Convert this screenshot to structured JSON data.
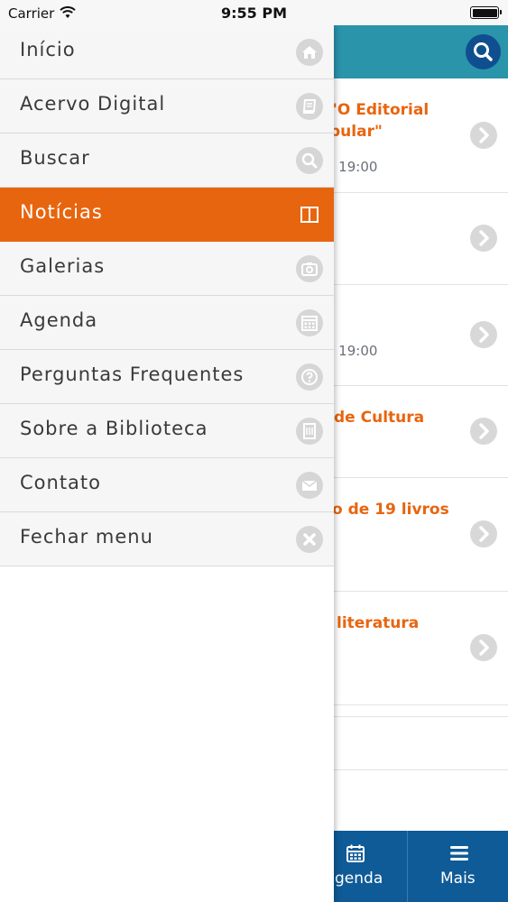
{
  "status_bar": {
    "carrier": "Carrier",
    "time": "9:55 PM"
  },
  "news": [
    {
      "title_line1": "\"O Editorial",
      "title_line2": "pular\"",
      "meta": "- 19:00"
    },
    {
      "title_line1": "",
      "title_line2": "",
      "meta": ""
    },
    {
      "title_line1": "",
      "title_line2": "",
      "meta": "- 19:00"
    },
    {
      "title_line1": "de Cultura",
      "title_line2": "",
      "meta": ""
    },
    {
      "title_line1": "o de 19 livros",
      "title_line2": "",
      "meta": ""
    },
    {
      "title_line1": "literatura",
      "title_line2": "",
      "meta": ""
    }
  ],
  "tabbar": {
    "agenda_label": "genda",
    "mais_label": "Mais"
  },
  "menu": {
    "items": [
      {
        "label": "Início",
        "icon": "home-icon"
      },
      {
        "label": "Acervo Digital",
        "icon": "book-icon"
      },
      {
        "label": "Buscar",
        "icon": "search-icon"
      },
      {
        "label": "Notícias",
        "icon": "newspaper-icon",
        "active": true
      },
      {
        "label": "Galerias",
        "icon": "camera-icon"
      },
      {
        "label": "Agenda",
        "icon": "calendar-icon"
      },
      {
        "label": "Perguntas Frequentes",
        "icon": "question-icon"
      },
      {
        "label": "Sobre a Biblioteca",
        "icon": "building-icon"
      },
      {
        "label": "Contato",
        "icon": "envelope-icon"
      },
      {
        "label": "Fechar menu",
        "icon": "close-icon"
      }
    ]
  },
  "colors": {
    "accent": "#e8650f",
    "header": "#2a94ab",
    "tabbar": "#0f5b97",
    "menu_bg": "#f6f6f6"
  }
}
